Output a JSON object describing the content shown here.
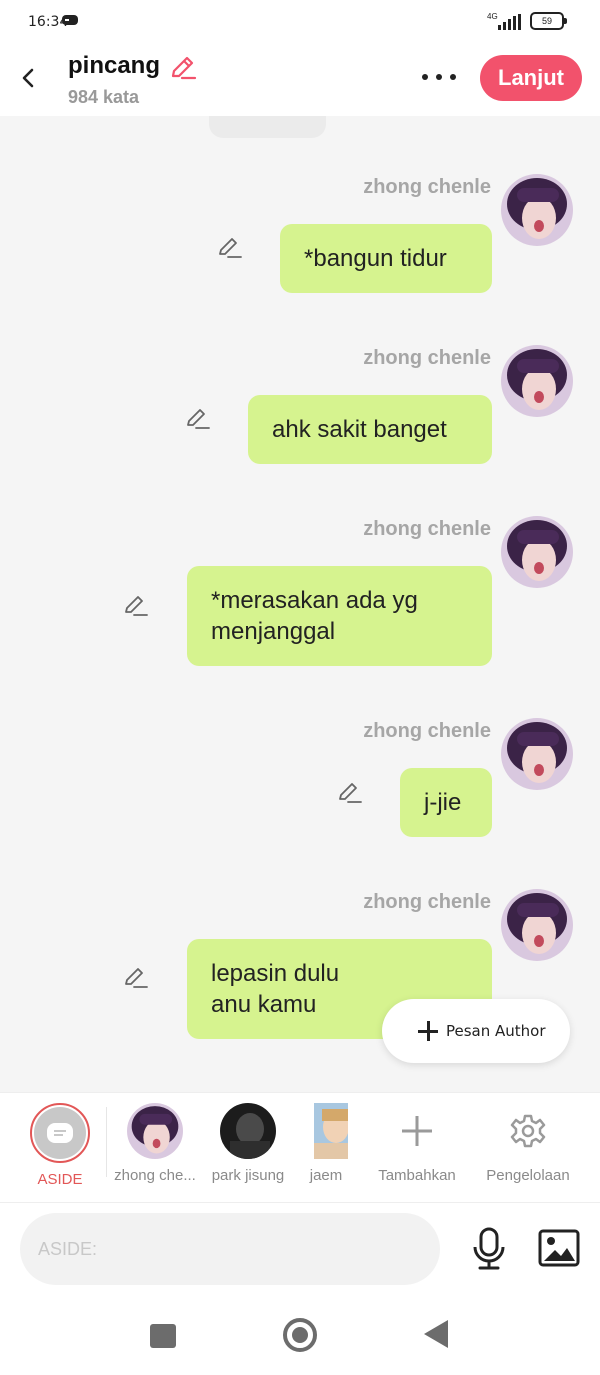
{
  "status": {
    "time": "16:34",
    "network": "4G",
    "battery": "59"
  },
  "header": {
    "title": "pincang",
    "word_count": "984 kata",
    "next_label": "Lanjut",
    "accent_color": "#f2526c"
  },
  "messages": [
    {
      "name": "zhong chenle",
      "text": "*bangun tidur"
    },
    {
      "name": "zhong chenle",
      "text": "ahk sakit banget"
    },
    {
      "name": "zhong chenle",
      "text": "*merasakan ada yg menjanggal"
    },
    {
      "name": "zhong chenle",
      "text": "j-jie"
    },
    {
      "name": "zhong chenle",
      "text": "lepasin dulu anu kamu"
    }
  ],
  "author_button": {
    "label": "Pesan Author"
  },
  "characters": {
    "aside": "ASIDE",
    "items": [
      {
        "label": "zhong che..."
      },
      {
        "label": "park jisung"
      },
      {
        "label": "jaem"
      }
    ],
    "add_label": "Tambahkan",
    "manage_label": "Pengelolaan"
  },
  "input": {
    "placeholder": "ASIDE:"
  }
}
